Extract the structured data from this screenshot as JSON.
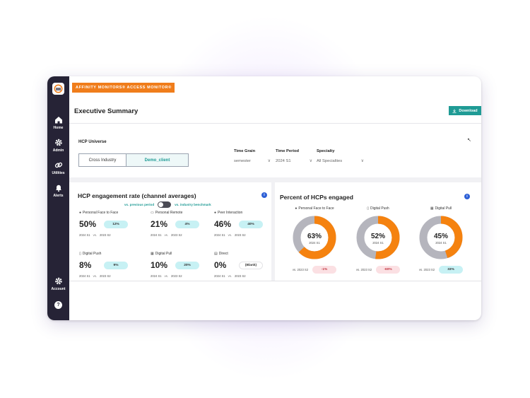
{
  "brand": {
    "label": "AFFINITY MONITORS® ACCESS MONITOR®"
  },
  "sidebar": {
    "items": [
      {
        "label": "Home",
        "icon": "home-icon"
      },
      {
        "label": "Admin",
        "icon": "gear-icon"
      },
      {
        "label": "Utilities",
        "icon": "link-icon"
      },
      {
        "label": "Alerts",
        "icon": "bell-icon"
      },
      {
        "label": "Account",
        "icon": "gear-icon"
      },
      {
        "label": "",
        "icon": "help-icon"
      }
    ],
    "help_glyph": "?"
  },
  "header": {
    "title": "Executive Summary",
    "download_label": "Download",
    "download_icon": "download-icon"
  },
  "universe": {
    "label": "HCP Universe",
    "options": [
      "Cross Industry",
      "Demo_client"
    ],
    "selected": "Demo_client"
  },
  "filters": [
    {
      "label": "Time Grain",
      "value": "semester"
    },
    {
      "label": "Time Period",
      "value": "2024 S1"
    },
    {
      "label": "Specialty",
      "value": "All Specialties"
    }
  ],
  "engagement": {
    "title": "HCP engagement rate (channel averages)",
    "info": "i",
    "toggle_left": "vs. previous period",
    "toggle_right": "vs. industry benchmark",
    "metrics": [
      {
        "label": "Personal Face to Face",
        "icon": "person-icon",
        "value": "50%",
        "delta": "12%",
        "current": "2024 S1",
        "vs": "vs.",
        "previous": "2023 S2",
        "tone": "teal"
      },
      {
        "label": "Personal Remote",
        "icon": "monitor-icon",
        "value": "21%",
        "delta": "4%",
        "current": "2024 S1",
        "vs": "vs.",
        "previous": "2023 S2",
        "tone": "teal"
      },
      {
        "label": "Peer Interaction",
        "icon": "people-icon",
        "value": "46%",
        "delta": "40%",
        "current": "2024 S1",
        "vs": "vs.",
        "previous": "2023 S2",
        "tone": "teal"
      },
      {
        "label": "Digital Push",
        "icon": "phone-icon",
        "value": "8%",
        "delta": "9%",
        "current": "2024 S1",
        "vs": "vs.",
        "previous": "2023 S2",
        "tone": "teal"
      },
      {
        "label": "Digital Pull",
        "icon": "calendar-icon",
        "value": "10%",
        "delta": "20%",
        "current": "2024 S1",
        "vs": "vs.",
        "previous": "2023 S2",
        "tone": "teal"
      },
      {
        "label": "Direct",
        "icon": "mail-icon",
        "value": "0%",
        "delta": "(Blank)",
        "current": "2024 S1",
        "vs": "vs.",
        "previous": "2023 S2",
        "tone": "white"
      }
    ]
  },
  "percent": {
    "title": "Percent of HCPs engaged",
    "info": "i",
    "donuts": [
      {
        "label": "Personal Face to Face",
        "icon": "person-icon",
        "value": "63%",
        "fraction": 0.63,
        "period": "2024 S1",
        "vs": "vs.",
        "previous": "2023 S2",
        "delta": "-1%",
        "tone": "pink"
      },
      {
        "label": "Digital Push",
        "icon": "phone-icon",
        "value": "52%",
        "fraction": 0.52,
        "period": "2024 S1",
        "vs": "vs.",
        "previous": "2023 S2",
        "delta": "-60%",
        "tone": "pink"
      },
      {
        "label": "Digital Pull",
        "icon": "calendar-icon",
        "value": "45%",
        "fraction": 0.45,
        "period": "2024 S1",
        "vs": "vs.",
        "previous": "2023 S2",
        "delta": "33%",
        "tone": "teal"
      }
    ],
    "colors": {
      "filled": "#f5820f",
      "rest": "#b5b5bd"
    }
  }
}
